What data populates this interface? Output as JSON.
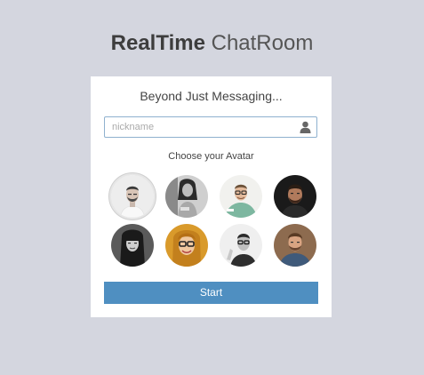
{
  "brand": {
    "bold": "RealTime",
    "light": "ChatRoom"
  },
  "card": {
    "tagline": "Beyond Just Messaging...",
    "nickname": {
      "value": "",
      "placeholder": "nickname",
      "icon": "user-icon"
    },
    "avatar_prompt": "Choose your Avatar",
    "avatars": [
      {
        "name": "avatar-1",
        "selected": true
      },
      {
        "name": "avatar-2",
        "selected": false
      },
      {
        "name": "avatar-3",
        "selected": false
      },
      {
        "name": "avatar-4",
        "selected": false
      },
      {
        "name": "avatar-5",
        "selected": false
      },
      {
        "name": "avatar-6",
        "selected": false
      },
      {
        "name": "avatar-7",
        "selected": false
      },
      {
        "name": "avatar-8",
        "selected": false
      }
    ],
    "start_label": "Start"
  },
  "colors": {
    "background": "#d4d6df",
    "card": "#ffffff",
    "accent": "#4f8fc1",
    "input_border": "#8fb1cf"
  }
}
